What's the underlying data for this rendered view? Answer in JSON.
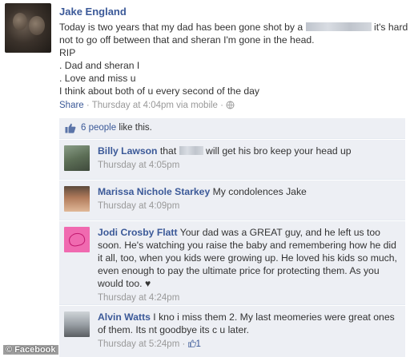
{
  "post": {
    "author": "Jake England",
    "lines": [
      "Today is two years that my dad has been gone shot by a",
      "it's hard",
      "not to go off between that and sheran I'm gone in the head.",
      "RIP",
      ". Dad and sheran I",
      ". Love and miss u",
      "I think about both of u every second of the day"
    ],
    "meta": {
      "share": "Share",
      "sep": " · ",
      "time": "Thursday at 4:04pm via mobile",
      "tail": " · "
    },
    "likes": {
      "count_label": "6 people",
      "suffix": " like this."
    }
  },
  "comments": [
    {
      "name": "Billy Lawson",
      "lines": [
        "that",
        "will get his bro keep your head up"
      ],
      "time": "Thursday at 4:05pm"
    },
    {
      "name": "Marissa Nichole Starkey",
      "lines": [
        "My condolences Jake"
      ],
      "time": "Thursday at 4:09pm"
    },
    {
      "name": "Jodi Crosby Flatt",
      "lines": [
        "Your dad was a GREAT guy, and he left us too",
        "soon. He's watching you raise the baby and remembering how he did",
        "it all, too, when you kids were growing up. He loved his kids so much,",
        "even enough to pay the ultimate price for protecting them. As you",
        "would too. ♥"
      ],
      "time": "Thursday at 4:24pm"
    },
    {
      "name": "Alvin Watts",
      "lines": [
        "I kno i miss them 2. My last meomeries were great ones",
        "of them. Its nt goodbye its c u later."
      ],
      "time": "Thursday at 5:24pm",
      "like_count": "1"
    }
  ],
  "watermark": "© Facebook",
  "colors": {
    "link": "#3b5998",
    "comment_bg": "#edeff4",
    "meta": "#999999"
  }
}
